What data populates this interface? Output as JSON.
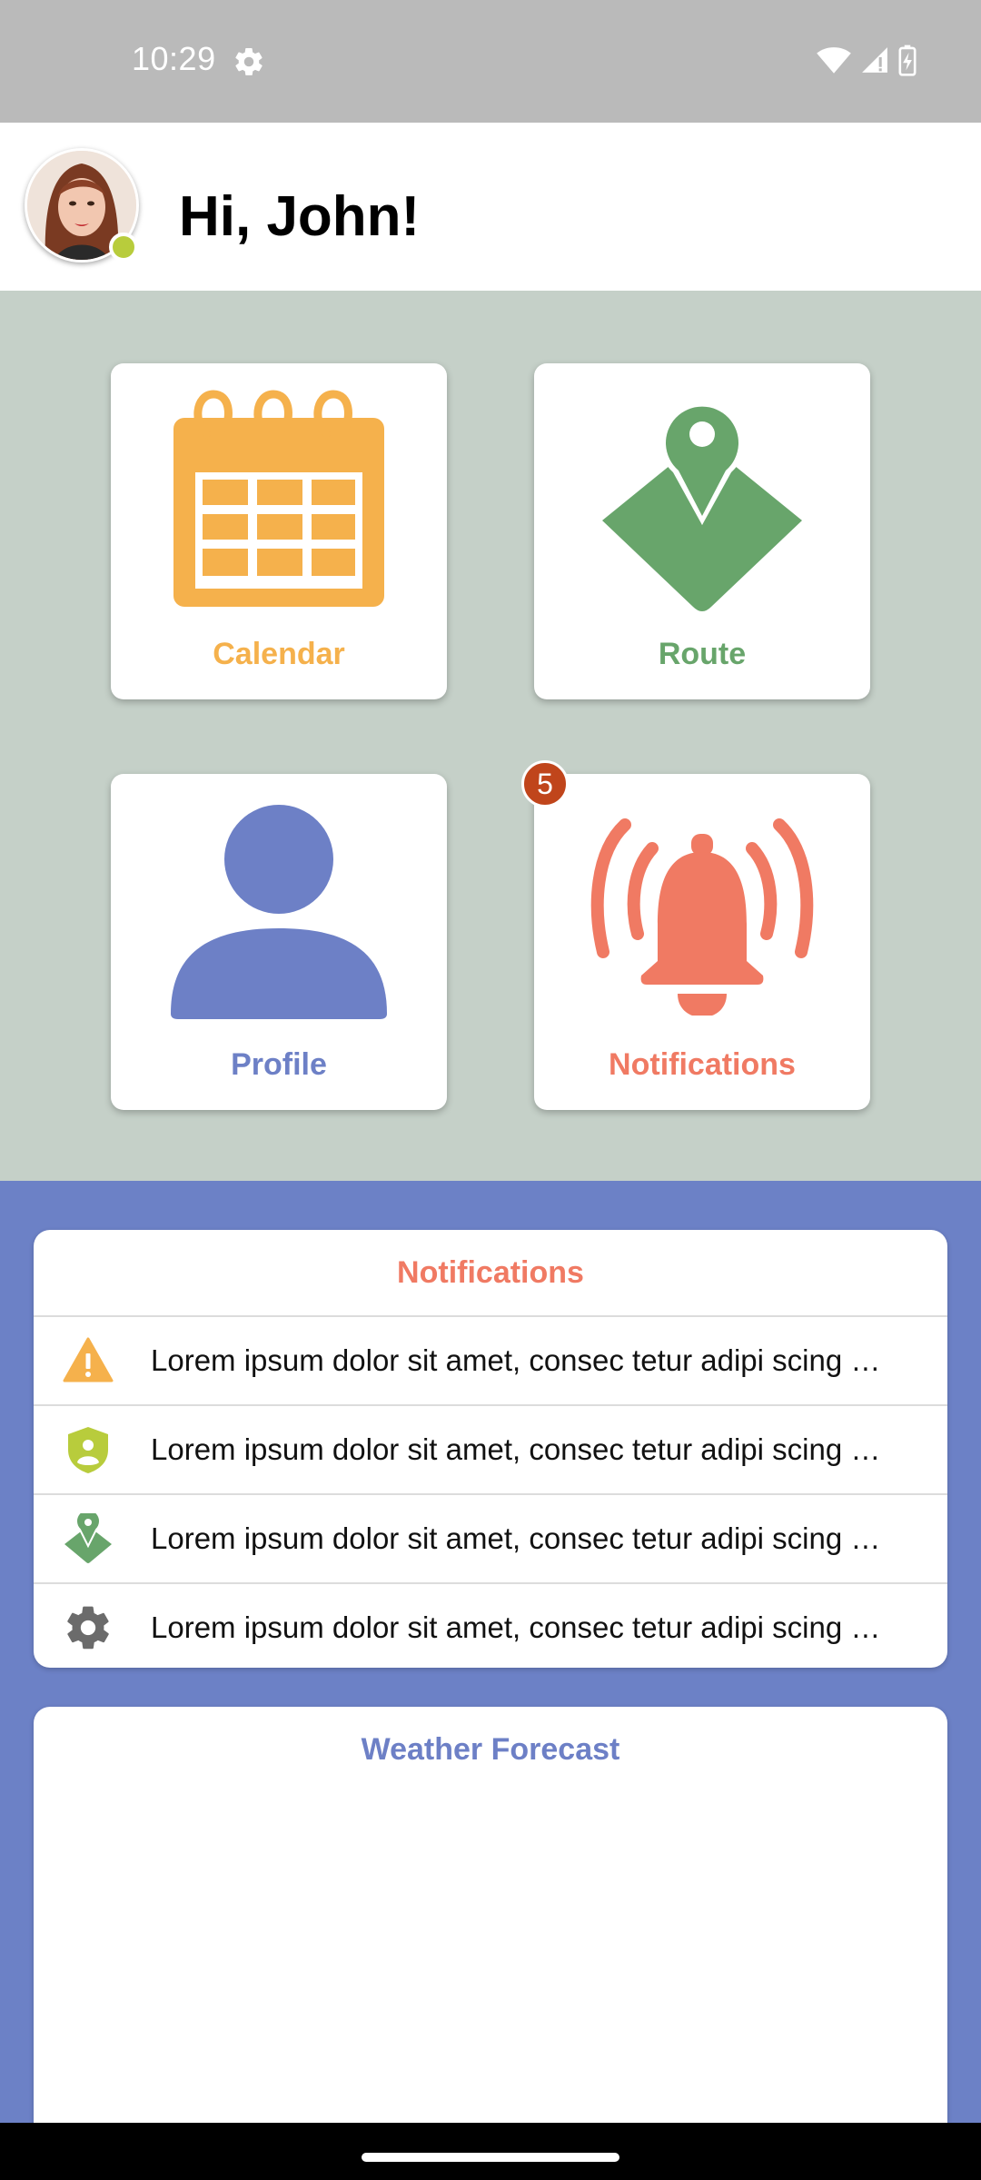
{
  "status_bar": {
    "time": "10:29",
    "icons": [
      "settings-gear-icon",
      "wifi-icon",
      "signal-icon",
      "battery-charging-icon"
    ]
  },
  "header": {
    "greeting": "Hi, John!",
    "avatar": "user-avatar",
    "status": "online"
  },
  "tiles": [
    {
      "label": "Calendar",
      "icon": "calendar-icon",
      "color": "#f5b14c"
    },
    {
      "label": "Route",
      "icon": "map-pin-icon",
      "color": "#68a56b"
    },
    {
      "label": "Profile",
      "icon": "person-icon",
      "color": "#6d80c6"
    },
    {
      "label": "Notifications",
      "icon": "bell-icon",
      "color": "#f07a63",
      "badge": "5"
    }
  ],
  "notifications_card": {
    "title": "Notifications",
    "items": [
      {
        "icon": "warning-icon",
        "text": "Lorem ipsum dolor sit amet, consec tetur adipi scing …"
      },
      {
        "icon": "shield-user-icon",
        "text": "Lorem ipsum dolor sit amet, consec tetur adipi scing …"
      },
      {
        "icon": "map-pin-icon",
        "text": "Lorem ipsum dolor sit amet, consec tetur adipi scing …"
      },
      {
        "icon": "gear-icon",
        "text": "Lorem ipsum dolor sit amet, consec tetur adipi scing …"
      }
    ]
  },
  "weather_card": {
    "title": "Weather Forecast"
  },
  "colors": {
    "accent_orange": "#f5b14c",
    "accent_green": "#68a56b",
    "accent_blue": "#6d80c6",
    "accent_coral": "#f07a63",
    "grid_background": "#c5d0c8"
  }
}
